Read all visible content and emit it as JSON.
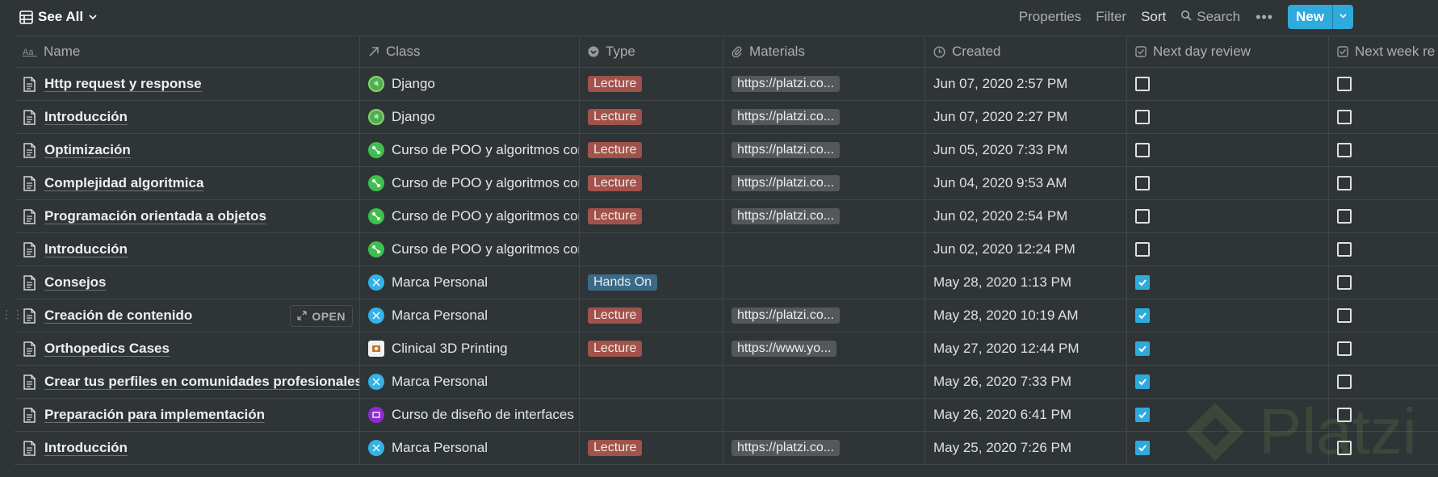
{
  "toolbar": {
    "view_label": "See All",
    "properties_label": "Properties",
    "filter_label": "Filter",
    "sort_label": "Sort",
    "search_label": "Search",
    "more_label": "•••",
    "new_label": "New"
  },
  "columns": {
    "name": "Name",
    "class": "Class",
    "type": "Type",
    "materials": "Materials",
    "created": "Created",
    "next_day": "Next day review",
    "next_week": "Next week re"
  },
  "open_label": "OPEN",
  "rows": [
    {
      "name": "Http request y response",
      "class": "Django",
      "class_icon": "django",
      "type": "Lecture",
      "materials": "https://platzi.co...",
      "created": "Jun 07, 2020 2:57 PM",
      "next_day": false,
      "next_week": false
    },
    {
      "name": "Introducción",
      "class": "Django",
      "class_icon": "django",
      "type": "Lecture",
      "materials": "https://platzi.co...",
      "created": "Jun 07, 2020 2:27 PM",
      "next_day": false,
      "next_week": false
    },
    {
      "name": "Optimización",
      "class": "Curso de POO y algoritmos con",
      "class_icon": "poo",
      "type": "Lecture",
      "materials": "https://platzi.co...",
      "created": "Jun 05, 2020 7:33 PM",
      "next_day": false,
      "next_week": false
    },
    {
      "name": "Complejidad algoritmica",
      "class": "Curso de POO y algoritmos con",
      "class_icon": "poo",
      "type": "Lecture",
      "materials": "https://platzi.co...",
      "created": "Jun 04, 2020 9:53 AM",
      "next_day": false,
      "next_week": false
    },
    {
      "name": "Programación orientada a objetos",
      "class": "Curso de POO y algoritmos con",
      "class_icon": "poo",
      "type": "Lecture",
      "materials": "https://platzi.co...",
      "created": "Jun 02, 2020 2:54 PM",
      "next_day": false,
      "next_week": false
    },
    {
      "name": "Introducción",
      "class": "Curso de POO y algoritmos con",
      "class_icon": "poo",
      "type": "",
      "materials": "",
      "created": "Jun 02, 2020 12:24 PM",
      "next_day": false,
      "next_week": false
    },
    {
      "name": "Consejos",
      "class": "Marca Personal",
      "class_icon": "marca",
      "type": "Hands On",
      "materials": "",
      "created": "May 28, 2020 1:13 PM",
      "next_day": true,
      "next_week": false
    },
    {
      "name": "Creación de contenido",
      "class": "Marca Personal",
      "class_icon": "marca",
      "type": "Lecture",
      "materials": "https://platzi.co...",
      "created": "May 28, 2020 10:19 AM",
      "next_day": true,
      "next_week": false,
      "hover": true
    },
    {
      "name": "Orthopedics Cases",
      "class": "Clinical 3D Printing",
      "class_icon": "clinical",
      "type": "Lecture",
      "materials": "https://www.yo...",
      "created": "May 27, 2020 12:44 PM",
      "next_day": true,
      "next_week": false
    },
    {
      "name": "Crear tus perfiles en comunidades profesionales",
      "class": "Marca Personal",
      "class_icon": "marca",
      "type": "",
      "materials": "",
      "created": "May 26, 2020 7:33 PM",
      "next_day": true,
      "next_week": false
    },
    {
      "name": "Preparación para implementación",
      "class": "Curso de diseño de interfaces",
      "class_icon": "diseno",
      "type": "",
      "materials": "",
      "created": "May 26, 2020 6:41 PM",
      "next_day": true,
      "next_week": false
    },
    {
      "name": "Introducción",
      "class": "Marca Personal",
      "class_icon": "marca",
      "type": "Lecture",
      "materials": "https://platzi.co...",
      "created": "May 25, 2020 7:26 PM",
      "next_day": true,
      "next_week": false
    }
  ],
  "colors": {
    "background": "#2f3437",
    "accent": "#2eaadc",
    "lecture_tag": "#a0524b",
    "handson_tag": "#3b6a87"
  }
}
